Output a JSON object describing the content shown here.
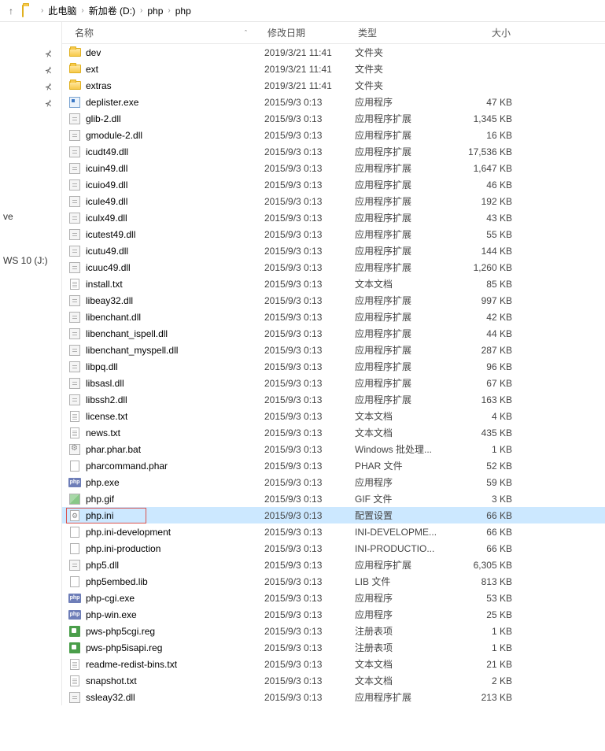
{
  "breadcrumb": {
    "items": [
      "此电脑",
      "新加卷 (D:)",
      "php",
      "php"
    ]
  },
  "sidebar": {
    "items": [
      "",
      "",
      "",
      "",
      "ve",
      "",
      "WS 10 (J:)"
    ]
  },
  "headers": {
    "name": "名称",
    "date": "修改日期",
    "type": "类型",
    "size": "大小"
  },
  "files": [
    {
      "icon": "folder",
      "name": "dev",
      "date": "2019/3/21 11:41",
      "type": "文件夹",
      "size": ""
    },
    {
      "icon": "folder",
      "name": "ext",
      "date": "2019/3/21 11:41",
      "type": "文件夹",
      "size": ""
    },
    {
      "icon": "folder",
      "name": "extras",
      "date": "2019/3/21 11:41",
      "type": "文件夹",
      "size": ""
    },
    {
      "icon": "exe",
      "name": "deplister.exe",
      "date": "2015/9/3 0:13",
      "type": "应用程序",
      "size": "47 KB"
    },
    {
      "icon": "dll",
      "name": "glib-2.dll",
      "date": "2015/9/3 0:13",
      "type": "应用程序扩展",
      "size": "1,345 KB"
    },
    {
      "icon": "dll",
      "name": "gmodule-2.dll",
      "date": "2015/9/3 0:13",
      "type": "应用程序扩展",
      "size": "16 KB"
    },
    {
      "icon": "dll",
      "name": "icudt49.dll",
      "date": "2015/9/3 0:13",
      "type": "应用程序扩展",
      "size": "17,536 KB"
    },
    {
      "icon": "dll",
      "name": "icuin49.dll",
      "date": "2015/9/3 0:13",
      "type": "应用程序扩展",
      "size": "1,647 KB"
    },
    {
      "icon": "dll",
      "name": "icuio49.dll",
      "date": "2015/9/3 0:13",
      "type": "应用程序扩展",
      "size": "46 KB"
    },
    {
      "icon": "dll",
      "name": "icule49.dll",
      "date": "2015/9/3 0:13",
      "type": "应用程序扩展",
      "size": "192 KB"
    },
    {
      "icon": "dll",
      "name": "iculx49.dll",
      "date": "2015/9/3 0:13",
      "type": "应用程序扩展",
      "size": "43 KB"
    },
    {
      "icon": "dll",
      "name": "icutest49.dll",
      "date": "2015/9/3 0:13",
      "type": "应用程序扩展",
      "size": "55 KB"
    },
    {
      "icon": "dll",
      "name": "icutu49.dll",
      "date": "2015/9/3 0:13",
      "type": "应用程序扩展",
      "size": "144 KB"
    },
    {
      "icon": "dll",
      "name": "icuuc49.dll",
      "date": "2015/9/3 0:13",
      "type": "应用程序扩展",
      "size": "1,260 KB"
    },
    {
      "icon": "txt",
      "name": "install.txt",
      "date": "2015/9/3 0:13",
      "type": "文本文档",
      "size": "85 KB"
    },
    {
      "icon": "dll",
      "name": "libeay32.dll",
      "date": "2015/9/3 0:13",
      "type": "应用程序扩展",
      "size": "997 KB"
    },
    {
      "icon": "dll",
      "name": "libenchant.dll",
      "date": "2015/9/3 0:13",
      "type": "应用程序扩展",
      "size": "42 KB"
    },
    {
      "icon": "dll",
      "name": "libenchant_ispell.dll",
      "date": "2015/9/3 0:13",
      "type": "应用程序扩展",
      "size": "44 KB"
    },
    {
      "icon": "dll",
      "name": "libenchant_myspell.dll",
      "date": "2015/9/3 0:13",
      "type": "应用程序扩展",
      "size": "287 KB"
    },
    {
      "icon": "dll",
      "name": "libpq.dll",
      "date": "2015/9/3 0:13",
      "type": "应用程序扩展",
      "size": "96 KB"
    },
    {
      "icon": "dll",
      "name": "libsasl.dll",
      "date": "2015/9/3 0:13",
      "type": "应用程序扩展",
      "size": "67 KB"
    },
    {
      "icon": "dll",
      "name": "libssh2.dll",
      "date": "2015/9/3 0:13",
      "type": "应用程序扩展",
      "size": "163 KB"
    },
    {
      "icon": "txt",
      "name": "license.txt",
      "date": "2015/9/3 0:13",
      "type": "文本文档",
      "size": "4 KB"
    },
    {
      "icon": "txt",
      "name": "news.txt",
      "date": "2015/9/3 0:13",
      "type": "文本文档",
      "size": "435 KB"
    },
    {
      "icon": "bat",
      "name": "phar.phar.bat",
      "date": "2015/9/3 0:13",
      "type": "Windows 批处理...",
      "size": "1 KB"
    },
    {
      "icon": "generic",
      "name": "pharcommand.phar",
      "date": "2015/9/3 0:13",
      "type": "PHAR 文件",
      "size": "52 KB"
    },
    {
      "icon": "php",
      "name": "php.exe",
      "date": "2015/9/3 0:13",
      "type": "应用程序",
      "size": "59 KB"
    },
    {
      "icon": "gif",
      "name": "php.gif",
      "date": "2015/9/3 0:13",
      "type": "GIF 文件",
      "size": "3 KB"
    },
    {
      "icon": "ini",
      "name": "php.ini",
      "date": "2015/9/3 0:13",
      "type": "配置设置",
      "size": "66 KB",
      "selected": true,
      "highlighted": true
    },
    {
      "icon": "generic",
      "name": "php.ini-development",
      "date": "2015/9/3 0:13",
      "type": "INI-DEVELOPME...",
      "size": "66 KB"
    },
    {
      "icon": "generic",
      "name": "php.ini-production",
      "date": "2015/9/3 0:13",
      "type": "INI-PRODUCTIO...",
      "size": "66 KB"
    },
    {
      "icon": "dll",
      "name": "php5.dll",
      "date": "2015/9/3 0:13",
      "type": "应用程序扩展",
      "size": "6,305 KB"
    },
    {
      "icon": "generic",
      "name": "php5embed.lib",
      "date": "2015/9/3 0:13",
      "type": "LIB 文件",
      "size": "813 KB"
    },
    {
      "icon": "php",
      "name": "php-cgi.exe",
      "date": "2015/9/3 0:13",
      "type": "应用程序",
      "size": "53 KB"
    },
    {
      "icon": "php",
      "name": "php-win.exe",
      "date": "2015/9/3 0:13",
      "type": "应用程序",
      "size": "25 KB"
    },
    {
      "icon": "reg",
      "name": "pws-php5cgi.reg",
      "date": "2015/9/3 0:13",
      "type": "注册表项",
      "size": "1 KB"
    },
    {
      "icon": "reg",
      "name": "pws-php5isapi.reg",
      "date": "2015/9/3 0:13",
      "type": "注册表项",
      "size": "1 KB"
    },
    {
      "icon": "txt",
      "name": "readme-redist-bins.txt",
      "date": "2015/9/3 0:13",
      "type": "文本文档",
      "size": "21 KB"
    },
    {
      "icon": "txt",
      "name": "snapshot.txt",
      "date": "2015/9/3 0:13",
      "type": "文本文档",
      "size": "2 KB"
    },
    {
      "icon": "dll",
      "name": "ssleay32.dll",
      "date": "2015/9/3 0:13",
      "type": "应用程序扩展",
      "size": "213 KB"
    }
  ]
}
